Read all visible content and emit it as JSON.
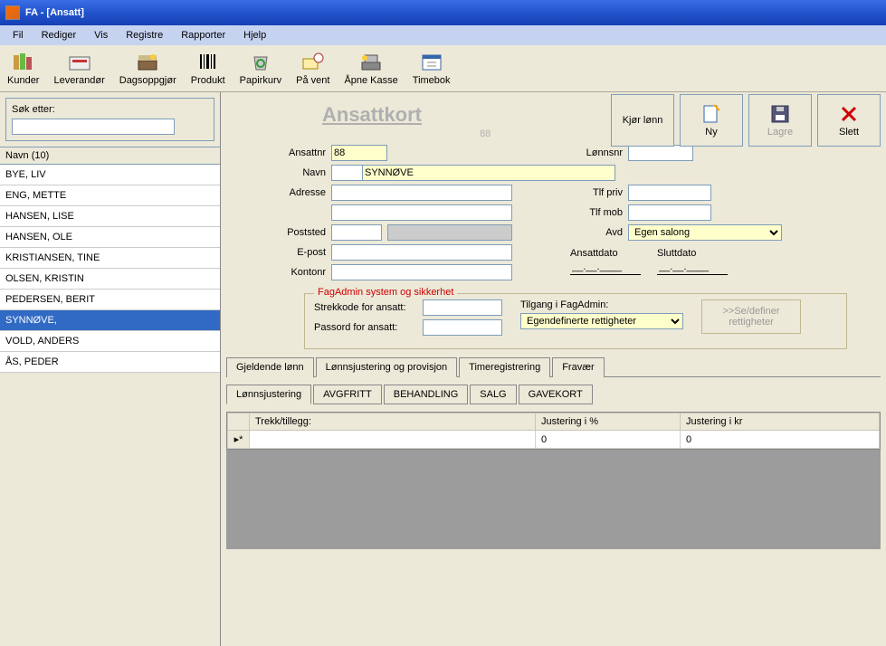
{
  "window": {
    "title": "FA - [Ansatt]"
  },
  "menu": [
    "Fil",
    "Rediger",
    "Vis",
    "Registre",
    "Rapporter",
    "Hjelp"
  ],
  "toolbar": [
    {
      "label": "Kunder",
      "icon": "books"
    },
    {
      "label": "Leverandør",
      "icon": "acme"
    },
    {
      "label": "Dagsoppgjør",
      "icon": "cashbox"
    },
    {
      "label": "Produkt",
      "icon": "barcode"
    },
    {
      "label": "Papirkurv",
      "icon": "recycle"
    },
    {
      "label": "På vent",
      "icon": "mailclock"
    },
    {
      "label": "Åpne Kasse",
      "icon": "till"
    },
    {
      "label": "Timebok",
      "icon": "calendar"
    }
  ],
  "search": {
    "label": "Søk etter:",
    "value": ""
  },
  "list": {
    "header": "Navn (10)",
    "items": [
      "BYE, LIV",
      "ENG, METTE",
      "HANSEN, LISE",
      "HANSEN, OLE",
      "KRISTIANSEN, TINE",
      "OLSEN, KRISTIN",
      "PEDERSEN, BERIT",
      "SYNNØVE,",
      "VOLD, ANDERS",
      "ÅS, PEDER"
    ],
    "selected_index": 7
  },
  "card": {
    "title": "Ansattkort",
    "subtitle": "88",
    "actions": {
      "run": "Kjør lønn",
      "new": "Ny",
      "save": "Lagre",
      "delete": "Slett"
    },
    "fields": {
      "ansattnr_label": "Ansattnr",
      "ansattnr": "88",
      "lonnsnr_label": "Lønnsnr",
      "lonnsnr": "",
      "navn_label": "Navn",
      "fornavn": "",
      "etternavn": "SYNNØVE",
      "adresse_label": "Adresse",
      "adresse1": "",
      "adresse2": "",
      "tlfpriv_label": "Tlf priv",
      "tlfpriv": "",
      "tlfmob_label": "Tlf mob",
      "tlfmob": "",
      "poststed_label": "Poststed",
      "postnr": "",
      "poststed": "",
      "avd_label": "Avd",
      "avd": "Egen salong",
      "epost_label": "E-post",
      "epost": "",
      "kontonr_label": "Kontonr",
      "kontonr": "",
      "ansattdato_label": "Ansattdato",
      "ansattdato": "__.__.____",
      "sluttdato_label": "Sluttdato",
      "sluttdato": "__.__.____"
    },
    "security": {
      "legend": "FagAdmin system og sikkerhet",
      "strekkode_label": "Strekkode for ansatt:",
      "strekkode": "",
      "passord_label": "Passord for ansatt:",
      "passord": "",
      "tilgang_label": "Tilgang i FagAdmin:",
      "tilgang": "Egendefinerte rettigheter",
      "rights_btn": ">>Se/definer rettigheter"
    }
  },
  "tabs": {
    "main": [
      "Gjeldende lønn",
      "Lønnsjustering og provisjon",
      "Timeregistrering",
      "Fravær"
    ],
    "main_active": 1,
    "sub": [
      "Lønnsjustering",
      "AVGFRITT",
      "BEHANDLING",
      "SALG",
      "GAVEKORT"
    ],
    "sub_active": 0
  },
  "grid": {
    "columns": [
      "Trekk/tillegg:",
      "Justering i %",
      "Justering i kr"
    ],
    "rows": [
      {
        "trekk": "",
        "pct": "0",
        "kr": "0"
      }
    ],
    "row_marker": "▸*"
  }
}
